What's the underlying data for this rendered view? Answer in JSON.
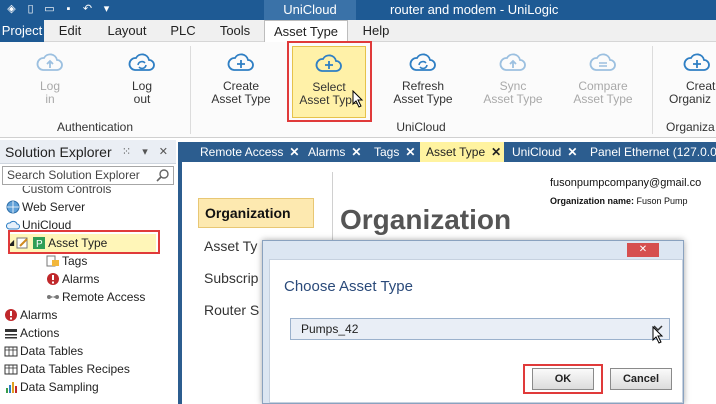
{
  "titlebar": {
    "context_tab": "UniCloud",
    "doc_title": "router and modem - UniLogic"
  },
  "menu_tabs": [
    "Project",
    "Edit",
    "Layout",
    "PLC",
    "Tools",
    "Asset Type",
    "Help"
  ],
  "ribbon": {
    "buttons": [
      {
        "label1": "Log",
        "label2": "in",
        "disabled": true,
        "icon": "cloud-up-icon"
      },
      {
        "label1": "Log",
        "label2": "out",
        "disabled": false,
        "icon": "cloud-refresh-icon"
      },
      {
        "label1": "Create",
        "label2": "Asset Type",
        "disabled": false,
        "icon": "cloud-add-icon"
      },
      {
        "label1": "Select",
        "label2": "Asset Type",
        "disabled": false,
        "icon": "cloud-add-icon"
      },
      {
        "label1": "Refresh",
        "label2": "Asset Type",
        "disabled": false,
        "icon": "cloud-refresh-icon"
      },
      {
        "label1": "Sync",
        "label2": "Asset Type",
        "disabled": true,
        "icon": "cloud-upload-icon"
      },
      {
        "label1": "Compare",
        "label2": "Asset Type",
        "disabled": true,
        "icon": "cloud-compare-icon"
      },
      {
        "label1": "Creat",
        "label2": "Organiz",
        "disabled": false,
        "icon": "cloud-add-icon"
      }
    ],
    "groups": [
      "Authentication",
      "UniCloud",
      "Organiza"
    ]
  },
  "solution_explorer": {
    "title": "Solution Explorer",
    "search_placeholder": "Search Solution Explorer",
    "items": [
      "Custom Controls",
      "Web Server",
      "UniCloud",
      "Asset Type",
      "Tags",
      "Alarms",
      "Remote Access",
      "Alarms",
      "Actions",
      "Data Tables",
      "Data Tables Recipes",
      "Data Sampling"
    ]
  },
  "doc_tabs": [
    "Remote Access",
    "Alarms",
    "Tags",
    "Asset Type",
    "UniCloud",
    "Panel Ethernet (127.0.0."
  ],
  "content": {
    "side_items": [
      "Organization",
      "Asset Ty",
      "Subscrip",
      "Router S"
    ],
    "heading": "Organization",
    "email": "fusonpumpcompany@gmail.co",
    "org_label": "Organization name:",
    "org_value": "Fuson Pump"
  },
  "modal": {
    "title": "Choose Asset Type",
    "selected_value": "Pumps_42",
    "ok_label": "OK",
    "cancel_label": "Cancel"
  },
  "colors": {
    "titlebar": "#1e5a94",
    "doc_tabs": "#2c5d8f",
    "highlight": "#e03a3a",
    "selected_tab": "#fff3a0"
  }
}
